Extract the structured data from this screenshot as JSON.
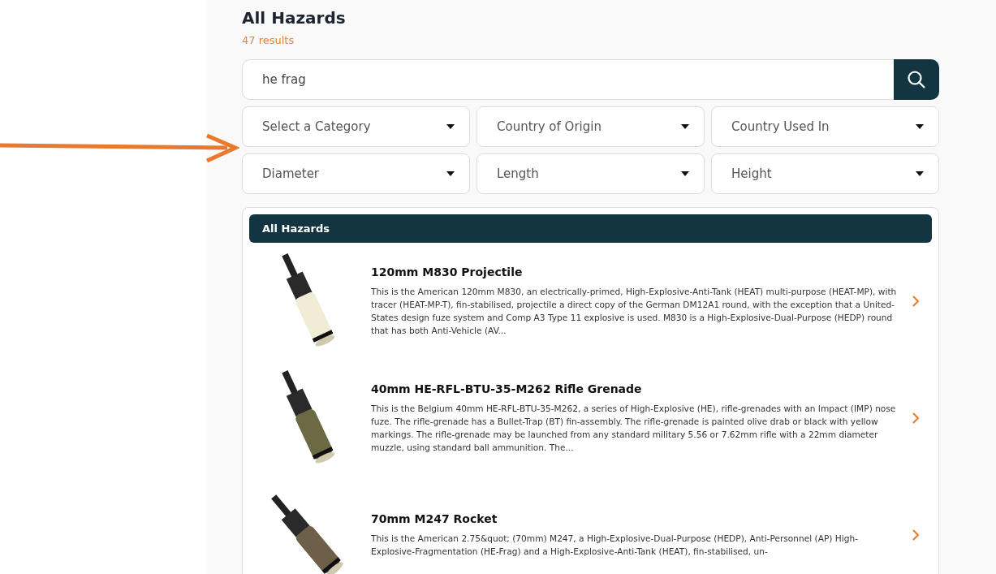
{
  "header": {
    "title": "All Hazards",
    "count": "47 results"
  },
  "search": {
    "value": "he frag"
  },
  "filters": [
    {
      "placeholder": "Select a Category"
    },
    {
      "placeholder": "Country of Origin"
    },
    {
      "placeholder": "Country Used In"
    },
    {
      "placeholder": "Diameter"
    },
    {
      "placeholder": "Length"
    },
    {
      "placeholder": "Height"
    }
  ],
  "list": {
    "title": "All Hazards",
    "items": [
      {
        "title": "120mm M830 Projectile",
        "description": "This is the American 120mm M830, an electrically-primed, High-Explosive-Anti-Tank (HEAT) multi-purpose (HEAT-MP), with tracer (HEAT-MP-T), fin-stabilised, projectile a direct copy of the German DM12A1 round, with the exception that a United-States design fuze system and Comp A3 Type 11 explosive is used. M830 is a High-Explosive-Dual-Purpose (HEDP) round that has both Anti-Vehicle (AV..."
      },
      {
        "title": "40mm HE-RFL-BTU-35-M262 Rifle Grenade",
        "description": "This is the Belgium 40mm HE-RFL-BTU-35-M262, a series of High-Explosive (HE), rifle-grenades with an Impact (IMP) nose fuze. The rifle-grenade has a Bullet-Trap (BT) fin-assembly. The rifle-grenade is painted olive drab or black with yellow markings. The rifle-grenade may be launched from any standard military 5.56 or 7.62mm rifle with a 22mm diameter muzzle, using standard ball ammunition. The..."
      },
      {
        "title": "70mm M247 Rocket",
        "description": "This is the American 2.75&quot; (70mm) M247, a High-Explosive-Dual-Purpose (HEDP), Anti-Personnel (AP) High-Explosive-Fragmentation (HE-Frag) and a High-Explosive-Anti-Tank (HEAT), fin-stabilised, un-"
      }
    ]
  }
}
